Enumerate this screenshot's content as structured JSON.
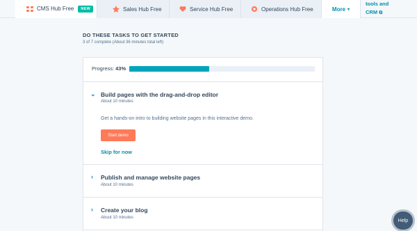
{
  "tabs": [
    {
      "label": "CMS Hub Free",
      "badge": "NEW",
      "icon": "cms-hub-icon",
      "active": true
    },
    {
      "label": "Sales Hub Free",
      "icon": "sales-hub-icon",
      "active": false
    },
    {
      "label": "Service Hub Free",
      "icon": "service-hub-icon",
      "active": false
    },
    {
      "label": "Operations Hub Free",
      "icon": "operations-hub-icon",
      "active": false
    }
  ],
  "more": {
    "label": "More"
  },
  "sidelink": {
    "line1": "tools and",
    "line2": "CRM"
  },
  "header": {
    "title": "DO THESE TASKS TO GET STARTED",
    "subtitle": "3 of 7 complete (About 36 minutes total left)"
  },
  "progress": {
    "label": "Progress:",
    "percent_text": "43%",
    "value": 0.43
  },
  "tasks": [
    {
      "title": "Build pages with the drag-and-drop editor",
      "time": "About 10 minutes",
      "description": "Get a hands-on intro to building website pages in this interactive demo.",
      "button": "Start demo",
      "skip": "Skip for now",
      "expanded": true
    },
    {
      "title": "Publish and manage website pages",
      "time": "About 10 minutes",
      "expanded": false
    },
    {
      "title": "Create your blog",
      "time": "About 10 minutes",
      "expanded": false
    }
  ],
  "help": {
    "label": "Help"
  },
  "colors": {
    "accent": "#00a4bd",
    "cta": "#ff7a59",
    "link": "#0091ae",
    "badge": "#00bda5"
  }
}
